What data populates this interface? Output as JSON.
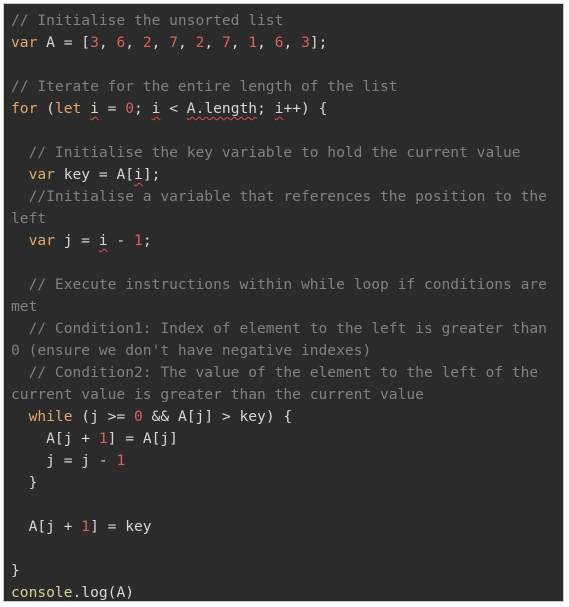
{
  "colors": {
    "background": "#2b2b2b",
    "comment": "#808080",
    "keyword": "#e2a868",
    "number": "#d9625b",
    "text": "#d8d8d8",
    "function": "#d8d28c",
    "error_underline": "#d9504a"
  },
  "code": {
    "lines": [
      [
        [
          "c",
          "// Initialise the unsorted list"
        ]
      ],
      [
        [
          "k",
          "var"
        ],
        [
          "p",
          " A = ["
        ],
        [
          "n",
          "3"
        ],
        [
          "p",
          ", "
        ],
        [
          "n",
          "6"
        ],
        [
          "p",
          ", "
        ],
        [
          "n",
          "2"
        ],
        [
          "p",
          ", "
        ],
        [
          "n",
          "7"
        ],
        [
          "p",
          ", "
        ],
        [
          "n",
          "2"
        ],
        [
          "p",
          ", "
        ],
        [
          "n",
          "7"
        ],
        [
          "p",
          ", "
        ],
        [
          "n",
          "1"
        ],
        [
          "p",
          ", "
        ],
        [
          "n",
          "6"
        ],
        [
          "p",
          ", "
        ],
        [
          "n",
          "3"
        ],
        [
          "p",
          "];"
        ]
      ],
      [],
      [
        [
          "c",
          "// Iterate for the entire length of the list"
        ]
      ],
      [
        [
          "k",
          "for"
        ],
        [
          "p",
          " ("
        ],
        [
          "k",
          "let"
        ],
        [
          "p",
          " "
        ],
        [
          "u",
          "i"
        ],
        [
          "p",
          " = "
        ],
        [
          "n",
          "0"
        ],
        [
          "p",
          "; "
        ],
        [
          "u",
          "i"
        ],
        [
          "p",
          " < "
        ],
        [
          "u",
          "A.length"
        ],
        [
          "p",
          "; "
        ],
        [
          "u",
          "i"
        ],
        [
          "p",
          "++) {"
        ]
      ],
      [],
      [
        [
          "c",
          "  // Initialise the key variable to hold the current value"
        ]
      ],
      [
        [
          "p",
          "  "
        ],
        [
          "k",
          "var"
        ],
        [
          "p",
          " key = A["
        ],
        [
          "u",
          "i"
        ],
        [
          "p",
          "];"
        ]
      ],
      [
        [
          "c",
          "  //Initialise a variable that references the position to the"
        ]
      ],
      [
        [
          "c",
          "left"
        ]
      ],
      [
        [
          "p",
          "  "
        ],
        [
          "k",
          "var"
        ],
        [
          "p",
          " j = "
        ],
        [
          "u",
          "i"
        ],
        [
          "p",
          " - "
        ],
        [
          "n",
          "1"
        ],
        [
          "p",
          ";"
        ]
      ],
      [],
      [
        [
          "c",
          "  // Execute instructions within while loop if conditions are"
        ]
      ],
      [
        [
          "c",
          "met"
        ]
      ],
      [
        [
          "c",
          "  // Condition1: Index of element to the left is greater than"
        ]
      ],
      [
        [
          "c",
          "0 (ensure we don't have negative indexes)"
        ]
      ],
      [
        [
          "c",
          "  // Condition2: The value of the element to the left of the"
        ]
      ],
      [
        [
          "c",
          "current value is greater than the current value"
        ]
      ],
      [
        [
          "p",
          "  "
        ],
        [
          "k",
          "while"
        ],
        [
          "p",
          " (j >= "
        ],
        [
          "n",
          "0"
        ],
        [
          "p",
          " && A[j] > key) {"
        ]
      ],
      [
        [
          "p",
          "    A[j + "
        ],
        [
          "n",
          "1"
        ],
        [
          "p",
          "] = A[j]"
        ]
      ],
      [
        [
          "p",
          "    j = j - "
        ],
        [
          "n",
          "1"
        ]
      ],
      [
        [
          "p",
          "  }"
        ]
      ],
      [],
      [
        [
          "p",
          "  A[j + "
        ],
        [
          "n",
          "1"
        ],
        [
          "p",
          "] = key"
        ]
      ],
      [],
      [
        [
          "p",
          "}"
        ]
      ],
      [
        [
          "f",
          "console"
        ],
        [
          "p",
          ".log(A)"
        ]
      ]
    ]
  }
}
